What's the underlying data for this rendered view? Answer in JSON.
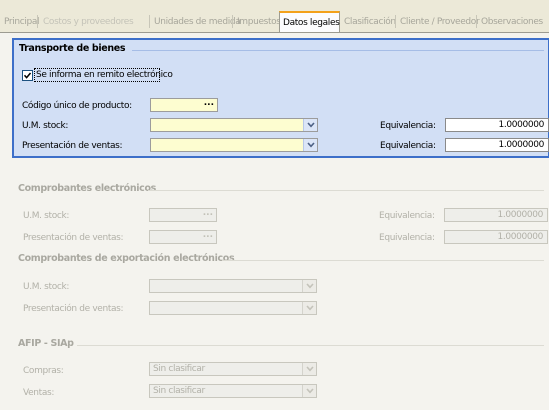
{
  "tabs": [
    {
      "label": "Principal",
      "active": false
    },
    {
      "label": "Costos y proveedores",
      "active": false
    },
    {
      "label": "Unidades de medida",
      "active": false
    },
    {
      "label": "Impuestos",
      "active": false
    },
    {
      "label": "Datos legales",
      "active": true
    },
    {
      "label": "Clasificación",
      "active": false
    },
    {
      "label": "Cliente / Proveedor",
      "active": false
    },
    {
      "label": "Observaciones",
      "active": false
    }
  ],
  "transporte": {
    "title": "Transporte de bienes",
    "checkbox_label": "Se informa en remito electrónico",
    "checkbox_checked": true,
    "codigo_label": "Código único de producto:",
    "codigo_value": "",
    "um_stock_label": "U.M. stock:",
    "um_stock_value": "",
    "presentacion_label": "Presentación de ventas:",
    "presentacion_value": "",
    "equivalencia_label": "Equivalencia:",
    "equivalencia_1": "1.0000000",
    "equivalencia_2": "1.0000000"
  },
  "comprobantes": {
    "title": "Comprobantes electrónicos",
    "um_stock_label": "U.M. stock:",
    "presentacion_label": "Presentación de ventas:",
    "equivalencia_label": "Equivalencia:",
    "equivalencia_1": "1.0000000",
    "equivalencia_2": "1.0000000"
  },
  "exportacion": {
    "title": "Comprobantes de exportación electrónicos",
    "um_stock_label": "U.M. stock:",
    "presentacion_label": "Presentación de ventas:"
  },
  "afip": {
    "title": "AFIP - SIAp",
    "compras_label": "Compras:",
    "compras_value": "Sin clasificar",
    "ventas_label": "Ventas:",
    "ventas_value": "Sin clasificar"
  },
  "icons": {
    "ellipsis": "...",
    "dropdown": "chevron-down-icon",
    "check": "checkmark-icon"
  },
  "colors": {
    "active_tab_accent": "#f3a11a",
    "section_border": "#3d6fc9",
    "section_bg": "#d2dff5",
    "input_yellow": "#fdfdd0"
  }
}
